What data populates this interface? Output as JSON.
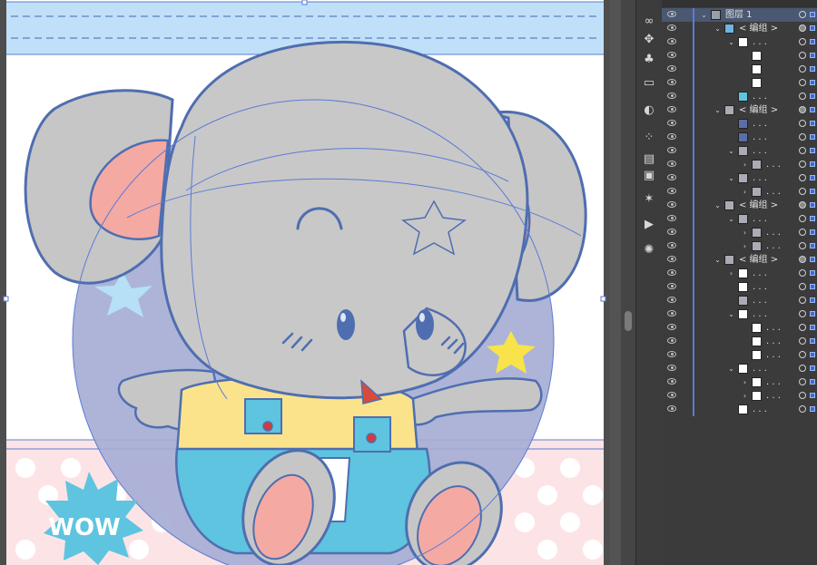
{
  "artwork": {
    "badge_text": "WOW"
  },
  "colors": {
    "canvas_bg": "#4e4e4e",
    "top_band": "#bfe0f8",
    "pink_band": "#fce4e6",
    "elephant_gray": "#c8c8c8",
    "ear_pink": "#f5a9a3",
    "outline_blue": "#4f6eb0",
    "overalls_blue": "#5ec4e0",
    "shirt_yellow": "#fbe38b",
    "star_yellow": "#f8e34a",
    "star_light_blue": "#b6e0f6",
    "selection_blue": "#5b7bd6"
  },
  "tools": [
    {
      "icon": "chain-link-icon"
    },
    {
      "icon": "puppet-warp-icon"
    },
    {
      "icon": "club-symbol-icon"
    },
    {
      "icon": "gradient-box-icon"
    },
    {
      "icon": "globe-icon"
    },
    {
      "icon": "dot-grid-icon"
    },
    {
      "icon": "align-icon"
    },
    {
      "icon": "pathfinder-icon"
    },
    {
      "icon": "magic-wand-icon"
    },
    {
      "icon": "play-action-icon"
    },
    {
      "icon": "sun-gear-icon"
    }
  ],
  "layers": {
    "rows": [
      {
        "indent": 0,
        "chevron": "v",
        "thumb": "layer",
        "name": "图层 1",
        "target": "ring",
        "selected": true
      },
      {
        "indent": 1,
        "chevron": "v",
        "thumb": "blue",
        "name": "< 编组 >",
        "target": "filled"
      },
      {
        "indent": 2,
        "chevron": "v",
        "thumb": "white",
        "name": ". . .",
        "target": "ring"
      },
      {
        "indent": 3,
        "chevron": "",
        "thumb": "white",
        "name": "",
        "target": "ring"
      },
      {
        "indent": 3,
        "chevron": "",
        "thumb": "white",
        "name": "",
        "target": "ring"
      },
      {
        "indent": 3,
        "chevron": "",
        "thumb": "white",
        "name": "",
        "target": "ring"
      },
      {
        "indent": 2,
        "chevron": "",
        "thumb": "cyan",
        "name": ". . .",
        "target": "ring"
      },
      {
        "indent": 1,
        "chevron": "v",
        "thumb": "gray",
        "name": "< 编组 >",
        "target": "filled"
      },
      {
        "indent": 2,
        "chevron": "",
        "thumb": "darkblue",
        "name": ". . .",
        "target": "ring"
      },
      {
        "indent": 2,
        "chevron": "",
        "thumb": "darkblue",
        "name": ". . .",
        "target": "ring"
      },
      {
        "indent": 2,
        "chevron": "v",
        "thumb": "gray",
        "name": ". . .",
        "target": "ring"
      },
      {
        "indent": 3,
        "chevron": ">",
        "thumb": "gray",
        "name": ". . .",
        "target": "ring"
      },
      {
        "indent": 2,
        "chevron": "v",
        "thumb": "gray",
        "name": ". . .",
        "target": "ring"
      },
      {
        "indent": 3,
        "chevron": ">",
        "thumb": "gray",
        "name": ". . .",
        "target": "ring"
      },
      {
        "indent": 1,
        "chevron": "v",
        "thumb": "gray",
        "name": "< 编组 >",
        "target": "filled"
      },
      {
        "indent": 2,
        "chevron": "v",
        "thumb": "gray",
        "name": ". . .",
        "target": "ring"
      },
      {
        "indent": 3,
        "chevron": ">",
        "thumb": "gray",
        "name": ". . .",
        "target": "ring"
      },
      {
        "indent": 3,
        "chevron": ">",
        "thumb": "gray",
        "name": ". . .",
        "target": "ring"
      },
      {
        "indent": 1,
        "chevron": "v",
        "thumb": "gray",
        "name": "< 编组 >",
        "target": "filled"
      },
      {
        "indent": 2,
        "chevron": ">",
        "thumb": "white",
        "name": ". . .",
        "target": "ring"
      },
      {
        "indent": 2,
        "chevron": "",
        "thumb": "white",
        "name": ". . .",
        "target": "ring"
      },
      {
        "indent": 2,
        "chevron": "",
        "thumb": "gray",
        "name": ". . .",
        "target": "ring"
      },
      {
        "indent": 2,
        "chevron": "v",
        "thumb": "white",
        "name": ". . .",
        "target": "ring"
      },
      {
        "indent": 3,
        "chevron": "",
        "thumb": "white",
        "name": ". . .",
        "target": "ring"
      },
      {
        "indent": 3,
        "chevron": "",
        "thumb": "white",
        "name": ". . .",
        "target": "ring"
      },
      {
        "indent": 3,
        "chevron": "",
        "thumb": "white",
        "name": ". . .",
        "target": "ring"
      },
      {
        "indent": 2,
        "chevron": "v",
        "thumb": "white",
        "name": ". . .",
        "target": "ring"
      },
      {
        "indent": 3,
        "chevron": ">",
        "thumb": "white",
        "name": ". . .",
        "target": "ring"
      },
      {
        "indent": 3,
        "chevron": ">",
        "thumb": "white",
        "name": ". . .",
        "target": "ring"
      },
      {
        "indent": 2,
        "chevron": "",
        "thumb": "white",
        "name": ". . .",
        "target": "ring"
      }
    ]
  }
}
